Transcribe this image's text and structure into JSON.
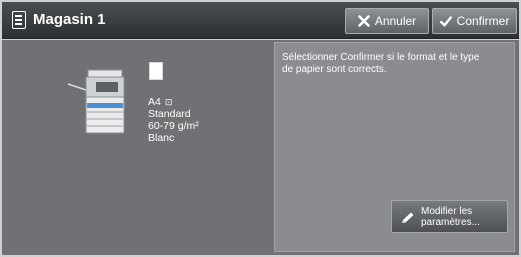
{
  "header": {
    "title": "Magasin 1",
    "cancel_label": "Annuler",
    "confirm_label": "Confirmer"
  },
  "paper": {
    "size": "A4",
    "orientation_glyph": "⊡",
    "type": "Standard",
    "weight": "60-79 g/m²",
    "color": "Blanc"
  },
  "panel": {
    "message": "Sélectionner Confirmer si le format et le type de papier sont corrects.",
    "modify_label": "Modifier les paramètres..."
  },
  "icons": {
    "menu": "document-list-icon",
    "cancel": "close-x-icon",
    "confirm": "checkmark-icon",
    "modify": "pencil-icon",
    "printer": "printer-icon",
    "paper": "paper-sheet-icon"
  },
  "colors": {
    "header_bg": "#2d3033",
    "content_bg": "#6f7174",
    "panel_bg": "#8a8c8f",
    "text": "#ffffff"
  }
}
